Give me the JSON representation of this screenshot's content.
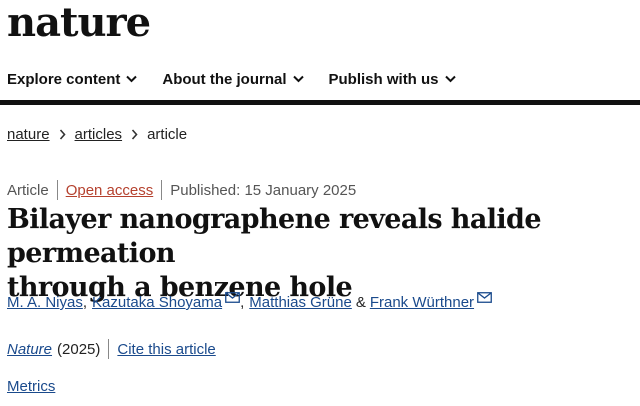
{
  "brand": {
    "logo_text": "nature"
  },
  "nav": {
    "items": [
      {
        "label": "Explore content"
      },
      {
        "label": "About the journal"
      },
      {
        "label": "Publish with us"
      }
    ]
  },
  "breadcrumb": {
    "items": [
      "nature",
      "articles",
      "article"
    ]
  },
  "article_meta": {
    "type": "Article",
    "access": "Open access",
    "published": "Published: 15 January 2025",
    "access_color": "#b5412e"
  },
  "article": {
    "title_line1": "Bilayer nanographene reveals halide permeation",
    "title_line2": "through a benzene hole"
  },
  "authors": {
    "list": [
      {
        "name": "M. A. Niyas",
        "corresponding": false
      },
      {
        "name": "Kazutaka Shoyama",
        "corresponding": true
      },
      {
        "name": "Matthias Grüne",
        "corresponding": false
      },
      {
        "name": "Frank Würthner",
        "corresponding": true
      }
    ],
    "comma": ",",
    "ampersand": "&"
  },
  "citation": {
    "journal": "Nature",
    "year": "(2025)",
    "cite_link": "Cite this article"
  },
  "metrics": {
    "label": "Metrics"
  },
  "colors": {
    "link": "#1a4a8c",
    "text": "#222222",
    "rule": "#111111"
  }
}
